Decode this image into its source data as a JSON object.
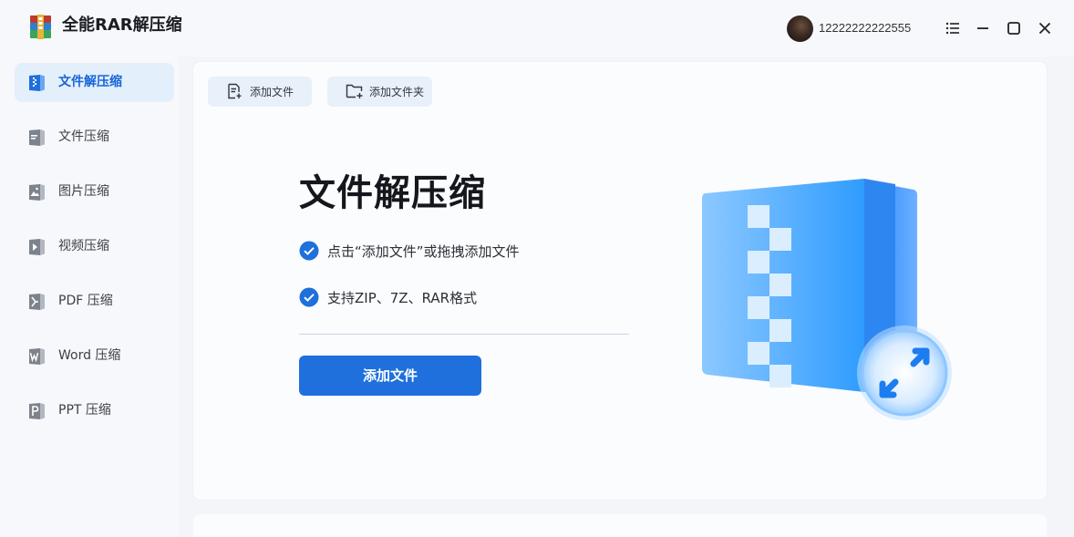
{
  "app": {
    "title": "全能RAR解压缩",
    "username": "12222222222555"
  },
  "sidebar": {
    "items": [
      {
        "label": "文件解压缩",
        "icon": "zip-extract-icon",
        "active": true
      },
      {
        "label": "文件压缩",
        "icon": "file-compress-icon",
        "active": false
      },
      {
        "label": "图片压缩",
        "icon": "image-compress-icon",
        "active": false
      },
      {
        "label": "视频压缩",
        "icon": "video-compress-icon",
        "active": false
      },
      {
        "label": "PDF 压缩",
        "icon": "pdf-compress-icon",
        "active": false
      },
      {
        "label": "Word 压缩",
        "icon": "word-compress-icon",
        "active": false
      },
      {
        "label": "PPT 压缩",
        "icon": "ppt-compress-icon",
        "active": false
      }
    ]
  },
  "toolbar": {
    "add_file_label": "添加文件",
    "add_folder_label": "添加文件夹"
  },
  "hero": {
    "title": "文件解压缩",
    "features": [
      "点击“添加文件”或拖拽添加文件",
      "支持ZIP、7Z、RAR格式"
    ],
    "button_label": "添加文件"
  },
  "colors": {
    "accent": "#1f6fdc",
    "active_bg": "#e4effc",
    "sidebar_bg": "#f6f8fb",
    "card_bg": "#fbfcfe"
  }
}
